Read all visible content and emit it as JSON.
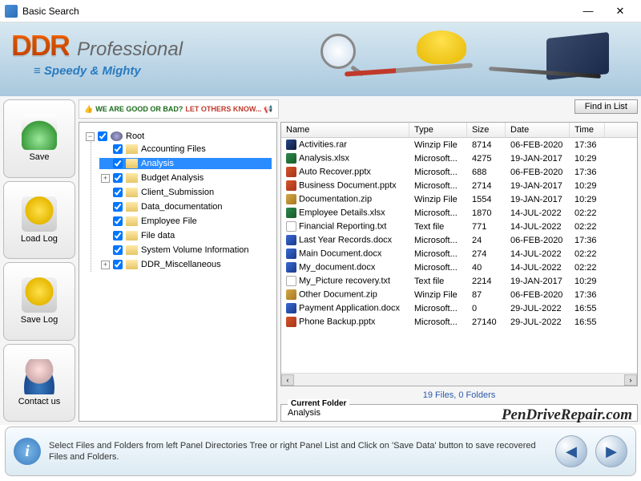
{
  "window": {
    "title": "Basic Search"
  },
  "banner": {
    "brand": "DDR",
    "product": "Professional",
    "tagline": "Speedy & Mighty"
  },
  "promo": {
    "line1": "WE ARE GOOD OR BAD?",
    "line2": "LET OTHERS KNOW..."
  },
  "buttons": {
    "find": "Find in List",
    "save": "Save",
    "load_log": "Load Log",
    "save_log": "Save Log",
    "contact": "Contact us"
  },
  "tree": {
    "root": "Root",
    "items": [
      {
        "label": "Accounting Files",
        "exp": ""
      },
      {
        "label": "Analysis",
        "exp": "",
        "selected": true
      },
      {
        "label": "Budget Analysis",
        "exp": "+"
      },
      {
        "label": "Client_Submission",
        "exp": ""
      },
      {
        "label": "Data_documentation",
        "exp": ""
      },
      {
        "label": "Employee File",
        "exp": ""
      },
      {
        "label": "File data",
        "exp": ""
      },
      {
        "label": "System Volume Information",
        "exp": ""
      },
      {
        "label": "DDR_Miscellaneous",
        "exp": "+"
      }
    ]
  },
  "list": {
    "headers": {
      "name": "Name",
      "type": "Type",
      "size": "Size",
      "date": "Date",
      "time": "Time"
    },
    "rows": [
      {
        "icon": "ps",
        "name": "Activities.rar",
        "type": "Winzip File",
        "size": "8714",
        "date": "06-FEB-2020",
        "time": "17:36"
      },
      {
        "icon": "xls",
        "name": "Analysis.xlsx",
        "type": "Microsoft...",
        "size": "4275",
        "date": "19-JAN-2017",
        "time": "10:29"
      },
      {
        "icon": "ppt",
        "name": "Auto Recover.pptx",
        "type": "Microsoft...",
        "size": "688",
        "date": "06-FEB-2020",
        "time": "17:36"
      },
      {
        "icon": "ppt",
        "name": "Business Document.pptx",
        "type": "Microsoft...",
        "size": "2714",
        "date": "19-JAN-2017",
        "time": "10:29"
      },
      {
        "icon": "zip",
        "name": "Documentation.zip",
        "type": "Winzip File",
        "size": "1554",
        "date": "19-JAN-2017",
        "time": "10:29"
      },
      {
        "icon": "xls",
        "name": "Employee Details.xlsx",
        "type": "Microsoft...",
        "size": "1870",
        "date": "14-JUL-2022",
        "time": "02:22"
      },
      {
        "icon": "txt",
        "name": "Financial Reporting.txt",
        "type": "Text file",
        "size": "771",
        "date": "14-JUL-2022",
        "time": "02:22"
      },
      {
        "icon": "doc",
        "name": "Last Year Records.docx",
        "type": "Microsoft...",
        "size": "24",
        "date": "06-FEB-2020",
        "time": "17:36"
      },
      {
        "icon": "doc",
        "name": "Main Document.docx",
        "type": "Microsoft...",
        "size": "274",
        "date": "14-JUL-2022",
        "time": "02:22"
      },
      {
        "icon": "doc",
        "name": "My_document.docx",
        "type": "Microsoft...",
        "size": "40",
        "date": "14-JUL-2022",
        "time": "02:22"
      },
      {
        "icon": "txt",
        "name": "My_Picture recovery.txt",
        "type": "Text file",
        "size": "2214",
        "date": "19-JAN-2017",
        "time": "10:29"
      },
      {
        "icon": "zip",
        "name": "Other Document.zip",
        "type": "Winzip File",
        "size": "87",
        "date": "06-FEB-2020",
        "time": "17:36"
      },
      {
        "icon": "doc",
        "name": "Payment Application.docx",
        "type": "Microsoft...",
        "size": "0",
        "date": "29-JUL-2022",
        "time": "16:55"
      },
      {
        "icon": "ppt",
        "name": "Phone Backup.pptx",
        "type": "Microsoft...",
        "size": "27140",
        "date": "29-JUL-2022",
        "time": "16:55"
      }
    ]
  },
  "status": "19 Files, 0 Folders",
  "current_folder": {
    "label": "Current Folder",
    "value": "Analysis"
  },
  "watermark": "PenDriveRepair.com",
  "footer": {
    "message": "Select Files and Folders from left Panel Directories Tree or right Panel List and Click on 'Save Data' button to save recovered Files and Folders."
  }
}
